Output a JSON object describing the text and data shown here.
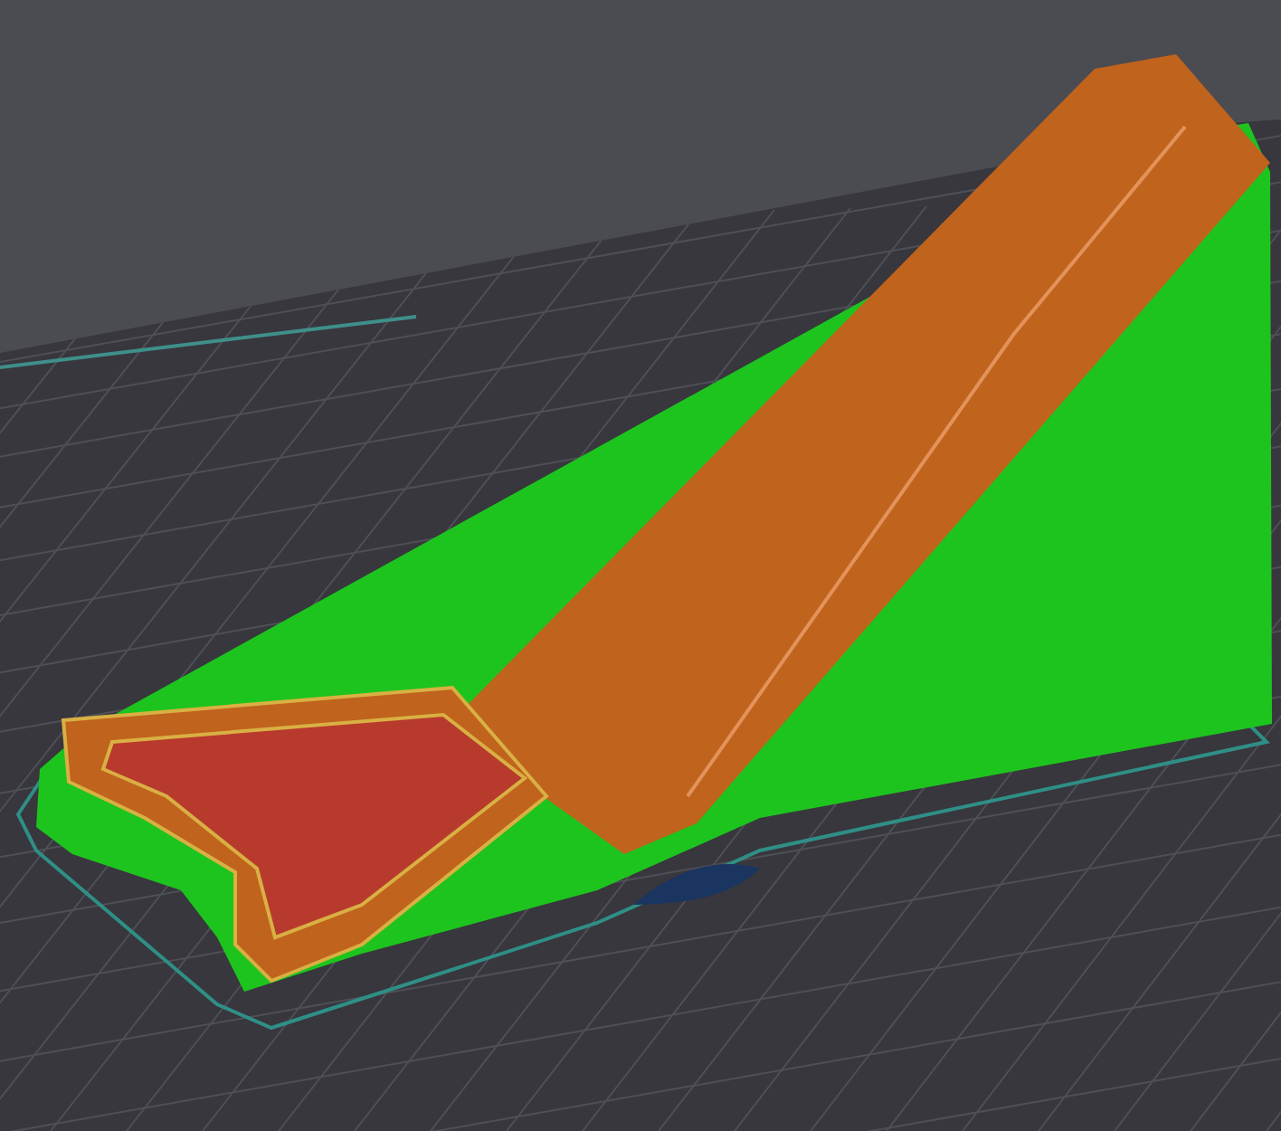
{
  "viewport": {
    "kind": "slice-preview"
  }
}
